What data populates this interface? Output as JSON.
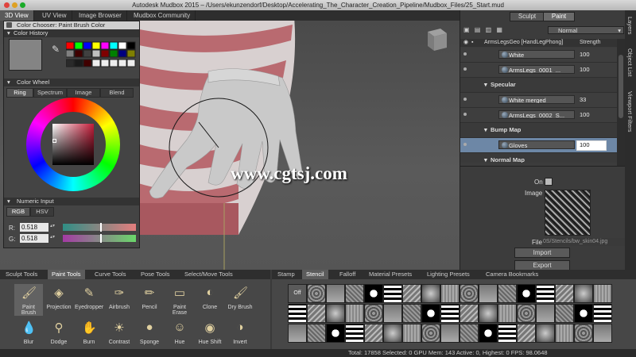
{
  "window": {
    "title": "Autodesk Mudbox 2015 – /Users/ekunzendorf/Desktop/Accelerating_The_Character_Creation_Pipeline/Mudbox_Files/25_Start.mud"
  },
  "top_tabs": [
    "3D View",
    "UV View",
    "Image Browser",
    "Mudbox Community"
  ],
  "color_chooser": {
    "title": "Color Chooser: Paint Brush Color",
    "history_label": "Color History",
    "wheel_label": "Color Wheel",
    "wheel_tabs": [
      "Ring",
      "Spectrum",
      "Image",
      "Blend"
    ],
    "numeric_label": "Numeric Input",
    "numeric_tabs": [
      "RGB",
      "HSV"
    ],
    "r_label": "R:",
    "r_value": "0.518",
    "g_label": "G:",
    "g_value": "0.518",
    "current_color": "#848484"
  },
  "watermark": "www.cgtsj.com",
  "right_panel": {
    "mode_tabs": [
      "Sculpt",
      "Paint"
    ],
    "blend_mode": "Normal",
    "header_layer": "ArmsLegsGeo [HandLegPhong]",
    "header_strength": "Strength",
    "rows": [
      {
        "type": "layer",
        "name": "White",
        "value": "100"
      },
      {
        "type": "layer",
        "name": "ArmsLegs_0001_...",
        "value": "100"
      },
      {
        "type": "group",
        "name": "Specular"
      },
      {
        "type": "layer",
        "name": "White merged",
        "value": "33"
      },
      {
        "type": "layer",
        "name": "ArmsLegs_0002_S...",
        "value": "100"
      },
      {
        "type": "group",
        "name": "Bump Map"
      },
      {
        "type": "layer",
        "name": "Gloves",
        "value": "100",
        "selected": true
      },
      {
        "type": "group",
        "name": "Normal Map"
      }
    ],
    "on_label": "On",
    "image_label": "Image",
    "file_label": "File",
    "file_value": "0S/Stencils/bw_skin04.jpg",
    "import_button": "Import",
    "export_button": "Export"
  },
  "side_strip": [
    "Layers",
    "Object List",
    "Viewport Filters"
  ],
  "tool_tabs": [
    "Sculpt Tools",
    "Paint Tools",
    "Curve Tools",
    "Pose Tools",
    "Select/Move Tools"
  ],
  "active_tool_tab": "Paint Tools",
  "paint_tools": [
    {
      "label": "Paint Brush",
      "icon": "paint-brush-icon"
    },
    {
      "label": "Projection",
      "icon": "projection-icon"
    },
    {
      "label": "Eyedropper",
      "icon": "eyedropper-icon"
    },
    {
      "label": "Airbrush",
      "icon": "airbrush-icon"
    },
    {
      "label": "Pencil",
      "icon": "pencil-icon"
    },
    {
      "label": "Paint Erase",
      "icon": "eraser-icon"
    },
    {
      "label": "Clone",
      "icon": "clone-icon"
    },
    {
      "label": "Dry Brush",
      "icon": "dry-brush-icon"
    },
    {
      "label": "Blur",
      "icon": "blur-icon"
    },
    {
      "label": "Dodge",
      "icon": "dodge-icon"
    },
    {
      "label": "Burn",
      "icon": "burn-icon"
    },
    {
      "label": "Contrast",
      "icon": "contrast-icon"
    },
    {
      "label": "Sponge",
      "icon": "sponge-icon"
    },
    {
      "label": "Hue",
      "icon": "hue-icon"
    },
    {
      "label": "Hue Shift",
      "icon": "hue-shift-icon"
    },
    {
      "label": "Invert",
      "icon": "invert-icon"
    }
  ],
  "stamp_tabs": [
    "Stamp",
    "Stencil",
    "Falloff",
    "Material Presets",
    "Lighting Presets",
    "Camera Bookmarks"
  ],
  "active_stamp_tab": "Stencil",
  "stencil_off_label": "Off",
  "status_bar": "Total: 17858  Selected: 0 GPU Mem: 143  Active: 0, Highest: 0  FPS: 98.0648"
}
